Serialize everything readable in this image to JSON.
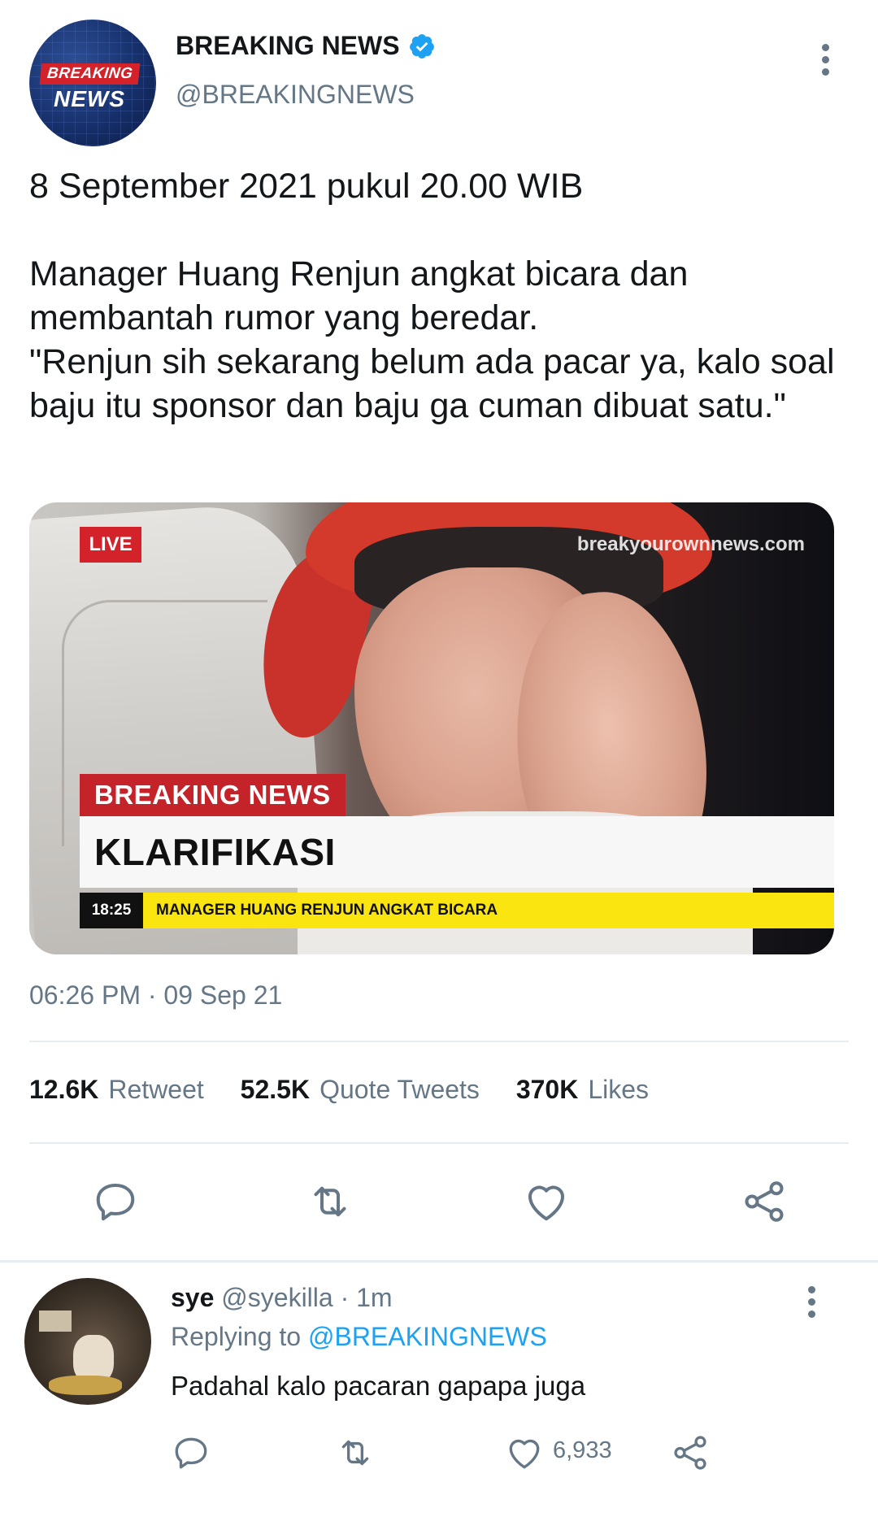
{
  "account": {
    "display_name": "BREAKING NEWS",
    "handle": "@BREAKINGNEWS",
    "avatar_text_top": "BREAKING",
    "avatar_text_bottom": "NEWS"
  },
  "tweet": {
    "text": "8 September 2021 pukul 20.00 WIB\n\nManager Huang Renjun angkat bicara dan membantah rumor yang beredar.\n\"Renjun sih sekarang belum ada pacar ya, kalo soal baju itu sponsor dan baju ga cuman dibuat satu.\"",
    "timestamp": "06:26 PM · 09 Sep 21"
  },
  "media": {
    "live_label": "LIVE",
    "watermark": "breakyourownnews.com",
    "breaking_label": "BREAKING NEWS",
    "headline": "KLARIFIKASI",
    "ticker_time": "18:25",
    "ticker_text": "MANAGER HUANG RENJUN ANGKAT BICARA"
  },
  "stats": {
    "retweets": {
      "count": "12.6K",
      "label": "Retweet"
    },
    "quotes": {
      "count": "52.5K",
      "label": "Quote Tweets"
    },
    "likes": {
      "count": "370K",
      "label": "Likes"
    }
  },
  "actions": [
    "reply-icon",
    "retweet-icon",
    "like-icon",
    "share-icon"
  ],
  "reply": {
    "name": "sye",
    "handle_time": "@syekilla · 1m",
    "replying_prefix": "Replying to",
    "replying_mention": "@BREAKINGNEWS",
    "text": "Padahal kalo pacaran gapapa juga",
    "like_count": "6,933"
  },
  "colors": {
    "accent_blue": "#1da1f2",
    "secondary_text": "#657786",
    "breaking_red": "#c4232a",
    "ticker_yellow": "#fbe510"
  }
}
